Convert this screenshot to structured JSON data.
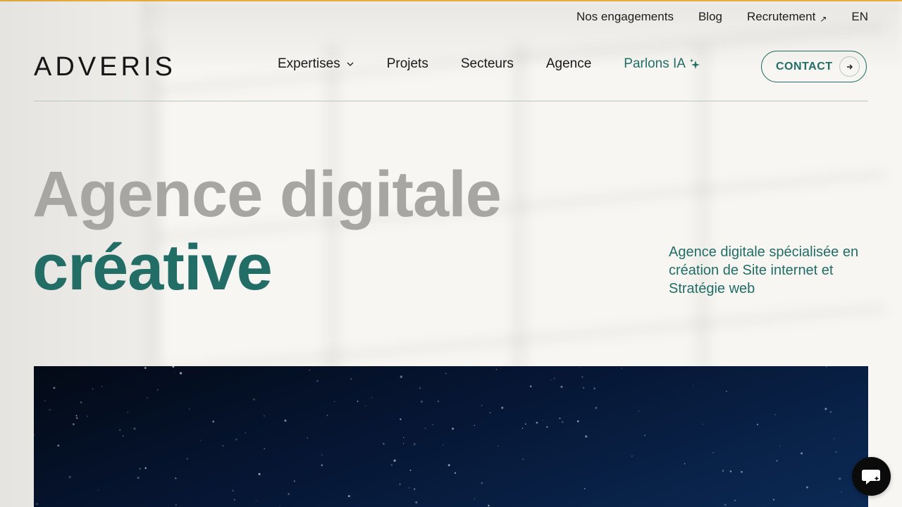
{
  "utility_nav": {
    "engagements": "Nos engagements",
    "blog": "Blog",
    "recruitment": "Recrutement",
    "recruitment_icon": "external-arrow-icon",
    "language": "EN"
  },
  "brand": {
    "logo": "ADVERIS"
  },
  "main_nav": {
    "expertises": "Expertises",
    "projects": "Projets",
    "sectors": "Secteurs",
    "agency": "Agence",
    "ai": "Parlons IA"
  },
  "contact_button": {
    "label": "CONTACT"
  },
  "hero": {
    "line1": "Agence digitale",
    "line2": "créative",
    "tagline": "Agence digitale spécialisée en création de Site internet et Stratégie web"
  },
  "colors": {
    "accent": "#226e66",
    "top_bar": "#f2b33d",
    "hero_grey": "#a7a6a2",
    "background": "#f7f6f2",
    "banner_dark": "#061634"
  },
  "icons": {
    "dropdown": "chevron-down-icon",
    "ai": "sparkle-icon",
    "contact": "arrow-right-icon",
    "chat": "chat-bubble-icon"
  }
}
